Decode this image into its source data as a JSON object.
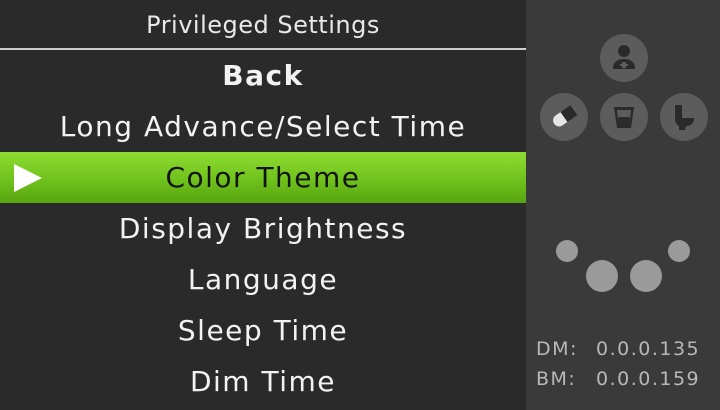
{
  "menu": {
    "title": "Privileged Settings",
    "items": [
      {
        "label": "Back",
        "bold": true,
        "selected": false
      },
      {
        "label": "Long Advance/Select Time",
        "bold": false,
        "selected": false
      },
      {
        "label": "Color Theme",
        "bold": false,
        "selected": true
      },
      {
        "label": "Display Brightness",
        "bold": false,
        "selected": false
      },
      {
        "label": "Language",
        "bold": false,
        "selected": false
      },
      {
        "label": "Sleep Time",
        "bold": false,
        "selected": false
      },
      {
        "label": "Dim Time",
        "bold": false,
        "selected": false
      }
    ]
  },
  "status_panel": {
    "icons": [
      "user-icon",
      "pill-icon",
      "cup-icon",
      "toilet-icon"
    ],
    "versions": [
      {
        "label": "DM:",
        "value": "0.0.0.135"
      },
      {
        "label": "BM:",
        "value": "0.0.0.159"
      }
    ]
  },
  "colors": {
    "selected_highlight": "#6fc21c",
    "menu_background": "#2a2a2a",
    "panel_background": "#3a3a3a"
  }
}
